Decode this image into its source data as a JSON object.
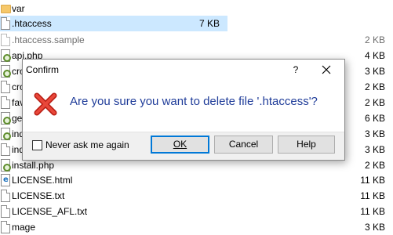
{
  "files": [
    {
      "name": "var",
      "size": "",
      "type": "folder",
      "icon": "folder-icon"
    },
    {
      "name": ".htaccess",
      "size": "7 KB",
      "type": "doc",
      "selected": true,
      "icon": "document-icon"
    },
    {
      "name": ".htaccess.sample",
      "size": "2 KB",
      "type": "doc",
      "hidden": true,
      "icon": "document-icon"
    },
    {
      "name": "api.php",
      "size": "4 KB",
      "type": "php",
      "icon": "php-file-icon"
    },
    {
      "name": "cro",
      "size": "3 KB",
      "type": "php",
      "icon": "php-file-icon"
    },
    {
      "name": "cro",
      "size": "2 KB",
      "type": "doc",
      "icon": "document-icon"
    },
    {
      "name": "fav",
      "size": "2 KB",
      "type": "doc",
      "icon": "document-icon"
    },
    {
      "name": "get",
      "size": "6 KB",
      "type": "php",
      "icon": "php-file-icon"
    },
    {
      "name": "ind",
      "size": "3 KB",
      "type": "php",
      "icon": "php-file-icon"
    },
    {
      "name": "ind",
      "size": "3 KB",
      "type": "doc",
      "icon": "document-icon"
    },
    {
      "name": "install.php",
      "size": "2 KB",
      "type": "php",
      "icon": "php-file-icon"
    },
    {
      "name": "LICENSE.html",
      "size": "11 KB",
      "type": "html",
      "icon": "html-file-icon"
    },
    {
      "name": "LICENSE.txt",
      "size": "11 KB",
      "type": "doc",
      "icon": "document-icon"
    },
    {
      "name": "LICENSE_AFL.txt",
      "size": "11 KB",
      "type": "doc",
      "icon": "document-icon"
    },
    {
      "name": "mage",
      "size": "3 KB",
      "type": "doc",
      "icon": "document-icon"
    }
  ],
  "dialog": {
    "title": "Confirm",
    "help_glyph": "?",
    "icon": "error-x-icon",
    "message": "Are you sure you want to delete file '.htaccess'?",
    "checkbox_label": "Never ask me again",
    "checkbox_checked": false,
    "buttons": {
      "ok": "OK",
      "cancel": "Cancel",
      "help": "Help"
    }
  },
  "colors": {
    "selection": "#cce8ff",
    "message_text": "#1f3c99",
    "error_icon": "#c42b1c",
    "focus_border": "#0078d7"
  }
}
